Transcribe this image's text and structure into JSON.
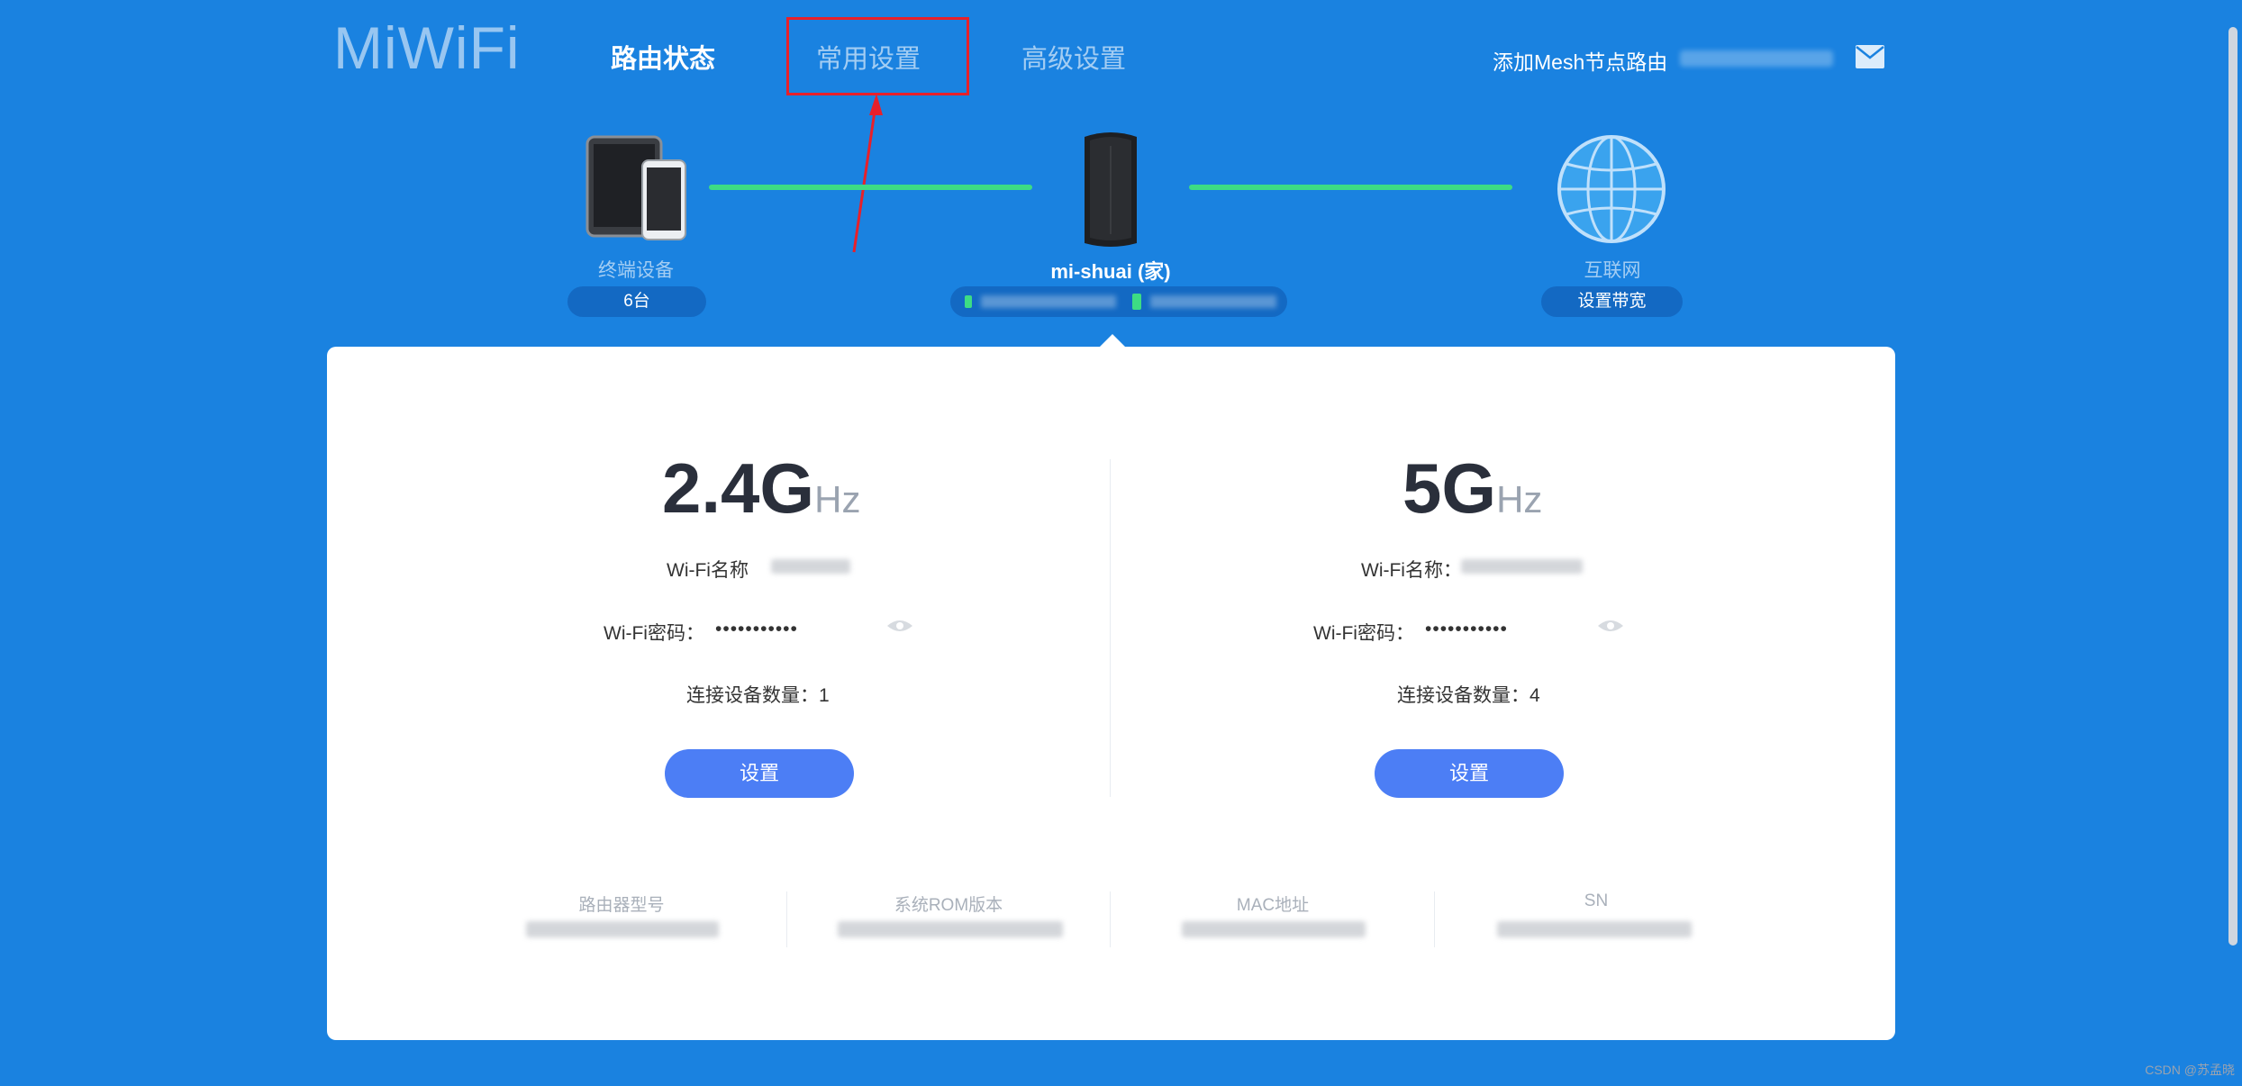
{
  "header": {
    "logo": "MiWiFi",
    "nav": [
      {
        "label": "路由状态"
      },
      {
        "label": "常用设置"
      },
      {
        "label": "高级设置"
      }
    ],
    "mesh_link": "添加Mesh节点路由"
  },
  "topology": {
    "devices": {
      "label": "终端设备",
      "count": "6台"
    },
    "router": {
      "name": "mi-shuai (家)"
    },
    "internet": {
      "label": "互联网",
      "action": "设置带宽"
    }
  },
  "bands": [
    {
      "title": "2.4G",
      "unit": "Hz",
      "wifi_name_label": "Wi-Fi名称",
      "wifi_password_label": "Wi-Fi密码：",
      "password": "•••••••••••",
      "connected_label": "连接设备数量：1",
      "button": "设置"
    },
    {
      "title": "5G",
      "unit": "Hz",
      "wifi_name_label": "Wi-Fi名称：",
      "wifi_password_label": "Wi-Fi密码：",
      "password": "•••••••••••",
      "connected_label": "连接设备数量：4",
      "button": "设置"
    }
  ],
  "info": [
    {
      "label": "路由器型号"
    },
    {
      "label": "系统ROM版本"
    },
    {
      "label": "MAC地址"
    },
    {
      "label": "SN"
    }
  ],
  "watermark": "CSDN @苏孟晓",
  "colors": {
    "background": "#1a82e0",
    "link_line": "#3ddc84",
    "button": "#4c7ef5",
    "highlight": "#e8202a"
  }
}
